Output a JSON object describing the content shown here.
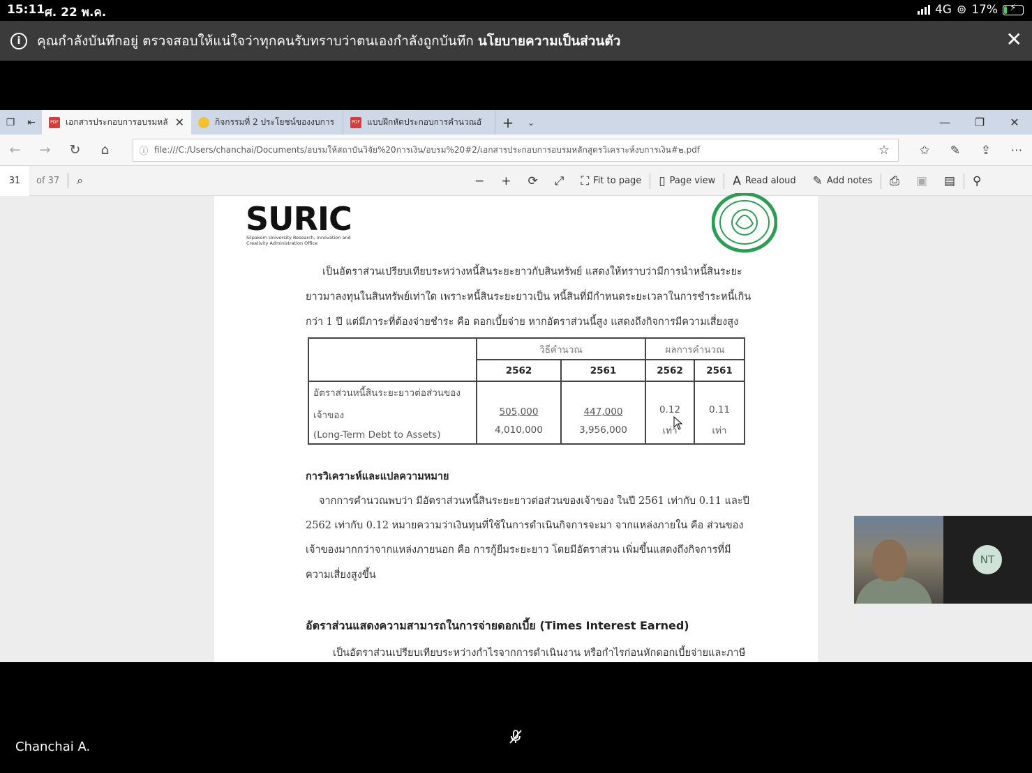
{
  "status_bar": {
    "time": "15:11",
    "date": "ศ. 22 พ.ค.",
    "network": "4G",
    "battery_percent": "17%",
    "battery_level": 0.17
  },
  "recording_banner": {
    "message": "คุณกำลังบันทึกอยู่ ตรวจสอบให้แน่ใจว่าทุกคนรับทราบว่าตนเองกำลังถูกบันทึก",
    "policy_link": "นโยบายความเป็นส่วนตัว"
  },
  "browser": {
    "tabs": [
      {
        "label": "เอกสารประกอบการอบรมหลั",
        "icon": "pdf-icon",
        "active": true
      },
      {
        "label": "กิจกรรมที่ 2 ประโยชน์ของงบการ",
        "icon": "emoji-icon",
        "active": false
      },
      {
        "label": "แบบฝึกหัดประกอบการคำนวณอั",
        "icon": "pdf-icon",
        "active": false
      }
    ],
    "url": "file:///C:/Users/chanchai/Documents/อบรมให้สถาบันวิจัย%20การเงิน/อบรม%20#2/เอกสารประกอบการอบรมหลักสูตรวิเคราะห์งบการเงิน#๒.pdf"
  },
  "pdf_toolbar": {
    "page_number": "31",
    "page_total": "of 37",
    "fit_to_page": "Fit to page",
    "page_view": "Page view",
    "read_aloud": "Read aloud",
    "add_notes": "Add notes"
  },
  "document": {
    "logo_text": "SURIC",
    "logo_subtitle": "Silpakorn University Research, Innovation and Creativity Administration Office",
    "intro_lines": [
      "เป็นอัตราส่วนเปรียบเทียบระหว่างหนี้สินระยะยาวกับสินทรัพย์ แสดงให้ทราบว่ามีการนำหนี้สินระยะ",
      "ยาวมาลงทุนในสินทรัพย์เท่าใด เพราะหนี้สินระยะยาวเป็น หนี้สินที่มีกำหนดระยะเวลาในการชำระหนี้เกิน",
      "กว่า 1 ปี แต่มีภาระที่ต้องจ่ายชำระ คือ ดอกเบี้ยจ่าย หากอัตราส่วนนี้สูง แสดงถึงกิจการมีความเสี่ยงสูง"
    ],
    "table": {
      "header_method": "วิธีคำนวณ",
      "header_result": "ผลการคำนวณ",
      "years": [
        "2562",
        "2561",
        "2562",
        "2561"
      ],
      "row_label_th_1": "อัตราส่วนหนี้สินระยะยาวต่อส่วนของ",
      "row_label_th_2": "เจ้าของ",
      "row_label_en": "(Long-Term Debt to Assets)",
      "numerator_2562": "505,000",
      "denominator_2562": "4,010,000",
      "numerator_2561": "447,000",
      "denominator_2561": "3,956,000",
      "result_2562": "0.12",
      "result_2561": "0.11",
      "unit_2562": "เท่า",
      "unit_2561": "เท่า"
    },
    "analysis_heading": "การวิเคราะห์และแปลความหมาย",
    "analysis_lines": [
      "จากการคำนวณพบว่า มีอัตราส่วนหนี้สินระยะยาวต่อส่วนของเจ้าของ ในปี 2561 เท่ากับ 0.11 และปี",
      "2562 เท่ากับ 0.12 หมายความว่าเงินทุนที่ใช้ในการดำเนินกิจการจะมา จากแหล่งภายใน คือ ส่วนของ",
      "เจ้าของมากกว่าจากแหล่งภายนอก คือ การกู้ยืมระยะยาว โดยมีอัตราส่วน เพิ่มขึ้นแสดงถึงกิจการที่มี",
      "ความเสี่ยงสูงขึ้น"
    ],
    "next_heading": "อัตราส่วนแสดงความสามารถในการจ่ายดอกเบี้ย (Times Interest Earned)",
    "next_line": "เป็นอัตราส่วนเปรียบเทียบระหว่างกำไรจากการดำเนินงาน หรือกำไรก่อนหักดอกเบี้ยจ่ายและภาษี"
  },
  "meeting": {
    "participant_initials": "NT",
    "presenter_name": "Chanchai A."
  },
  "colors": {
    "banner_bg": "#3b3b3b",
    "tabbar_bg": "#cfd8e6",
    "battery_green": "#3dd35a",
    "seal_green": "#2e9c55"
  }
}
